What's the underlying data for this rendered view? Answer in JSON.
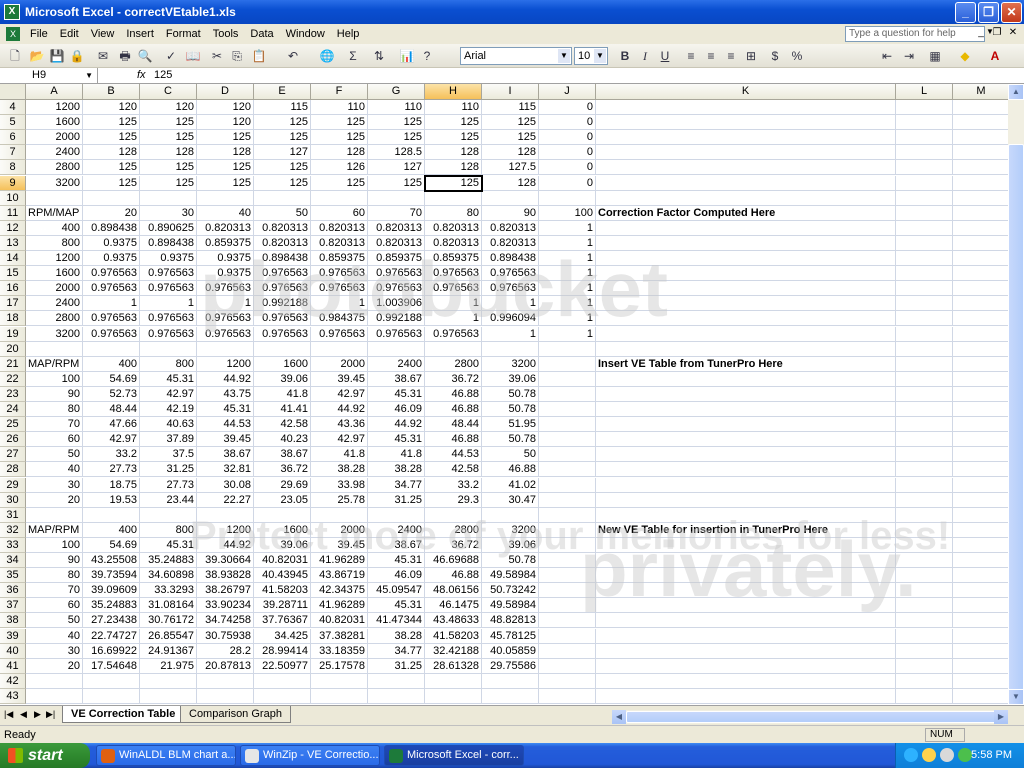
{
  "window": {
    "title": "Microsoft Excel - correctVEtable1.xls"
  },
  "menu": [
    "File",
    "Edit",
    "View",
    "Insert",
    "Format",
    "Tools",
    "Data",
    "Window",
    "Help"
  ],
  "help_placeholder": "Type a question for help",
  "toolbar": {
    "font": "Arial",
    "size": "10"
  },
  "formula": {
    "namebox": "H9",
    "fx": "fx",
    "value": "125"
  },
  "columns": [
    "A",
    "B",
    "C",
    "D",
    "E",
    "F",
    "G",
    "H",
    "I",
    "J",
    "K",
    "L",
    "M"
  ],
  "active": {
    "col": "H",
    "row": "9"
  },
  "rows": [
    {
      "n": "4",
      "c": [
        "1200",
        "120",
        "120",
        "120",
        "115",
        "110",
        "110",
        "110",
        "115",
        "0"
      ]
    },
    {
      "n": "5",
      "c": [
        "1600",
        "125",
        "125",
        "120",
        "125",
        "125",
        "125",
        "125",
        "125",
        "0"
      ]
    },
    {
      "n": "6",
      "c": [
        "2000",
        "125",
        "125",
        "125",
        "125",
        "125",
        "125",
        "125",
        "125",
        "0"
      ]
    },
    {
      "n": "7",
      "c": [
        "2400",
        "128",
        "128",
        "128",
        "127",
        "128",
        "128.5",
        "128",
        "128",
        "0"
      ]
    },
    {
      "n": "8",
      "c": [
        "2800",
        "125",
        "125",
        "125",
        "125",
        "126",
        "127",
        "128",
        "127.5",
        "0"
      ]
    },
    {
      "n": "9",
      "c": [
        "3200",
        "125",
        "125",
        "125",
        "125",
        "125",
        "125",
        "125",
        "128",
        "0"
      ]
    },
    {
      "n": "10",
      "c": []
    },
    {
      "n": "11",
      "c": [
        "RPM/MAP",
        "20",
        "30",
        "40",
        "50",
        "60",
        "70",
        "80",
        "90",
        "100"
      ],
      "k": "Correction Factor Computed Here"
    },
    {
      "n": "12",
      "c": [
        "400",
        "0.898438",
        "0.890625",
        "0.820313",
        "0.820313",
        "0.820313",
        "0.820313",
        "0.820313",
        "0.820313",
        "1"
      ]
    },
    {
      "n": "13",
      "c": [
        "800",
        "0.9375",
        "0.898438",
        "0.859375",
        "0.820313",
        "0.820313",
        "0.820313",
        "0.820313",
        "0.820313",
        "1"
      ]
    },
    {
      "n": "14",
      "c": [
        "1200",
        "0.9375",
        "0.9375",
        "0.9375",
        "0.898438",
        "0.859375",
        "0.859375",
        "0.859375",
        "0.898438",
        "1"
      ]
    },
    {
      "n": "15",
      "c": [
        "1600",
        "0.976563",
        "0.976563",
        "0.9375",
        "0.976563",
        "0.976563",
        "0.976563",
        "0.976563",
        "0.976563",
        "1"
      ]
    },
    {
      "n": "16",
      "c": [
        "2000",
        "0.976563",
        "0.976563",
        "0.976563",
        "0.976563",
        "0.976563",
        "0.976563",
        "0.976563",
        "0.976563",
        "1"
      ]
    },
    {
      "n": "17",
      "c": [
        "2400",
        "1",
        "1",
        "1",
        "0.992188",
        "1",
        "1.003906",
        "1",
        "1",
        "1"
      ]
    },
    {
      "n": "18",
      "c": [
        "2800",
        "0.976563",
        "0.976563",
        "0.976563",
        "0.976563",
        "0.984375",
        "0.992188",
        "1",
        "0.996094",
        "1"
      ]
    },
    {
      "n": "19",
      "c": [
        "3200",
        "0.976563",
        "0.976563",
        "0.976563",
        "0.976563",
        "0.976563",
        "0.976563",
        "0.976563",
        "1",
        "1"
      ]
    },
    {
      "n": "20",
      "c": []
    },
    {
      "n": "21",
      "c": [
        "MAP/RPM",
        "400",
        "800",
        "1200",
        "1600",
        "2000",
        "2400",
        "2800",
        "3200",
        ""
      ],
      "k": "Insert VE Table from TunerPro Here"
    },
    {
      "n": "22",
      "c": [
        "100",
        "54.69",
        "45.31",
        "44.92",
        "39.06",
        "39.45",
        "38.67",
        "36.72",
        "39.06",
        ""
      ]
    },
    {
      "n": "23",
      "c": [
        "90",
        "52.73",
        "42.97",
        "43.75",
        "41.8",
        "42.97",
        "45.31",
        "46.88",
        "50.78",
        ""
      ]
    },
    {
      "n": "24",
      "c": [
        "80",
        "48.44",
        "42.19",
        "45.31",
        "41.41",
        "44.92",
        "46.09",
        "46.88",
        "50.78",
        ""
      ]
    },
    {
      "n": "25",
      "c": [
        "70",
        "47.66",
        "40.63",
        "44.53",
        "42.58",
        "43.36",
        "44.92",
        "48.44",
        "51.95",
        ""
      ]
    },
    {
      "n": "26",
      "c": [
        "60",
        "42.97",
        "37.89",
        "39.45",
        "40.23",
        "42.97",
        "45.31",
        "46.88",
        "50.78",
        ""
      ]
    },
    {
      "n": "27",
      "c": [
        "50",
        "33.2",
        "37.5",
        "38.67",
        "38.67",
        "41.8",
        "41.8",
        "44.53",
        "50",
        ""
      ]
    },
    {
      "n": "28",
      "c": [
        "40",
        "27.73",
        "31.25",
        "32.81",
        "36.72",
        "38.28",
        "38.28",
        "42.58",
        "46.88",
        ""
      ]
    },
    {
      "n": "29",
      "c": [
        "30",
        "18.75",
        "27.73",
        "30.08",
        "29.69",
        "33.98",
        "34.77",
        "33.2",
        "41.02",
        ""
      ]
    },
    {
      "n": "30",
      "c": [
        "20",
        "19.53",
        "23.44",
        "22.27",
        "23.05",
        "25.78",
        "31.25",
        "29.3",
        "30.47",
        ""
      ]
    },
    {
      "n": "31",
      "c": []
    },
    {
      "n": "32",
      "c": [
        "MAP/RPM",
        "400",
        "800",
        "1200",
        "1600",
        "2000",
        "2400",
        "2800",
        "3200",
        ""
      ],
      "k": "New VE Table for insertion in TunerPro Here"
    },
    {
      "n": "33",
      "c": [
        "100",
        "54.69",
        "45.31",
        "44.92",
        "39.06",
        "39.45",
        "38.67",
        "36.72",
        "39.06",
        ""
      ]
    },
    {
      "n": "34",
      "c": [
        "90",
        "43.25508",
        "35.24883",
        "39.30664",
        "40.82031",
        "41.96289",
        "45.31",
        "46.69688",
        "50.78",
        ""
      ]
    },
    {
      "n": "35",
      "c": [
        "80",
        "39.73594",
        "34.60898",
        "38.93828",
        "40.43945",
        "43.86719",
        "46.09",
        "46.88",
        "49.58984",
        ""
      ]
    },
    {
      "n": "36",
      "c": [
        "70",
        "39.09609",
        "33.3293",
        "38.26797",
        "41.58203",
        "42.34375",
        "45.09547",
        "48.06156",
        "50.73242",
        ""
      ]
    },
    {
      "n": "37",
      "c": [
        "60",
        "35.24883",
        "31.08164",
        "33.90234",
        "39.28711",
        "41.96289",
        "45.31",
        "46.1475",
        "49.58984",
        ""
      ]
    },
    {
      "n": "38",
      "c": [
        "50",
        "27.23438",
        "30.76172",
        "34.74258",
        "37.76367",
        "40.82031",
        "41.47344",
        "43.48633",
        "48.82813",
        ""
      ]
    },
    {
      "n": "39",
      "c": [
        "40",
        "22.74727",
        "26.85547",
        "30.75938",
        "34.425",
        "37.38281",
        "38.28",
        "41.58203",
        "45.78125",
        ""
      ]
    },
    {
      "n": "40",
      "c": [
        "30",
        "16.69922",
        "24.91367",
        "28.2",
        "28.99414",
        "33.18359",
        "34.77",
        "32.42188",
        "40.05859",
        ""
      ]
    },
    {
      "n": "41",
      "c": [
        "20",
        "17.54648",
        "21.975",
        "20.87813",
        "22.50977",
        "25.17578",
        "31.25",
        "28.61328",
        "29.75586",
        ""
      ]
    },
    {
      "n": "42",
      "c": []
    },
    {
      "n": "43",
      "c": []
    }
  ],
  "tabs": [
    "VE Correction Table",
    "Comparison Graph"
  ],
  "status": {
    "ready": "Ready",
    "num": "NUM"
  },
  "taskbar": {
    "start": "start",
    "items": [
      "WinALDL BLM chart a...",
      "WinZip - VE Correctio...",
      "Microsoft Excel - corr..."
    ],
    "clock": "5:58 PM"
  },
  "watermarks": [
    "photobucket",
    "Protect more of your memories for less!",
    "privately."
  ]
}
